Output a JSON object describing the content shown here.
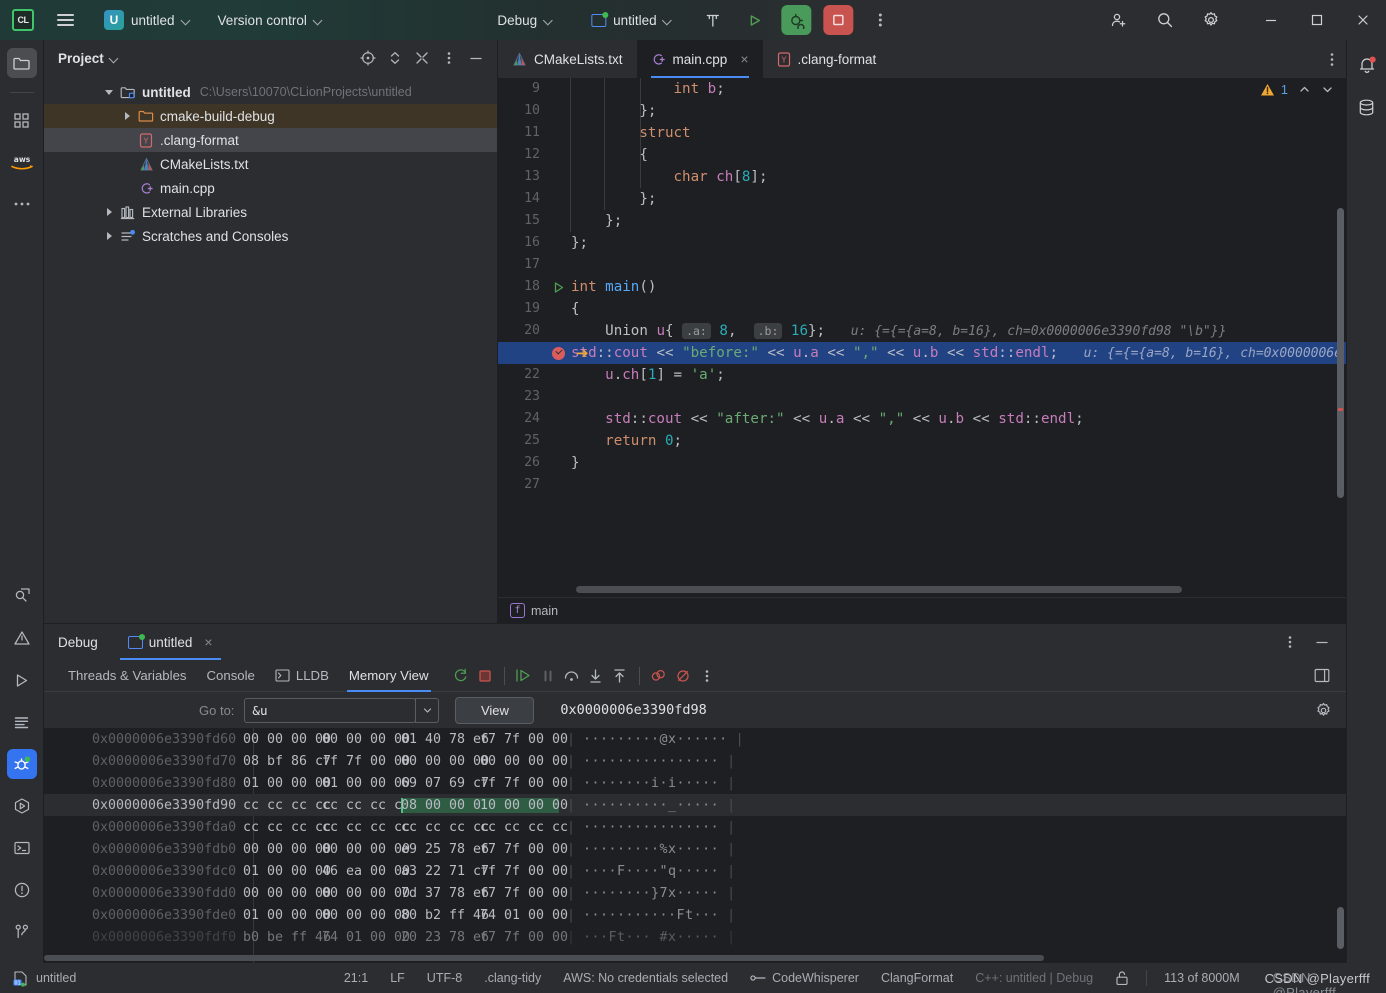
{
  "titlebar": {
    "logo": "CL",
    "menu_icon": "hamburger-menu-icon",
    "project_badge": "U",
    "project_name": "untitled",
    "version_control": "Version control",
    "run_config_mode": "Debug",
    "run_config_name": "untitled",
    "build_icon": "hammer-icon",
    "run_icon": "run-triangle-icon",
    "debug_icon": "debug-bug-icon",
    "stop_icon": "stop-square-icon",
    "more_icon": "more-vertical-icon",
    "add_user_icon": "add-user-icon",
    "search_icon": "search-icon",
    "settings_icon": "gear-icon",
    "minimize_icon": "window-minimize-icon",
    "maximize_icon": "window-maximize-icon",
    "close_icon": "window-close-icon"
  },
  "left_rail": {
    "items": [
      {
        "name": "project-tool-icon",
        "label": "Project",
        "active": true
      },
      {
        "name": "structure-tool-icon",
        "label": "Structure",
        "active": false
      },
      {
        "name": "aws-tool-icon",
        "label": "AWS",
        "active": false
      },
      {
        "name": "more-tools-icon",
        "label": "More tools",
        "active": false
      }
    ],
    "bottom_items": [
      {
        "name": "find-tool-icon",
        "label": "Find",
        "active": false
      },
      {
        "name": "problems-tool-icon",
        "label": "Problems",
        "active": false
      },
      {
        "name": "run-tool-icon",
        "label": "Run",
        "active": false
      },
      {
        "name": "todo-tool-icon",
        "label": "TODO",
        "active": false
      },
      {
        "name": "debug-tool-icon",
        "label": "Debug",
        "active": true
      },
      {
        "name": "cmake-tool-icon",
        "label": "CMake",
        "active": false
      },
      {
        "name": "terminal-tool-icon",
        "label": "Terminal",
        "active": false
      },
      {
        "name": "problems-alert-icon",
        "label": "Problems",
        "active": false
      },
      {
        "name": "git-branch-icon",
        "label": "Git",
        "active": false
      }
    ]
  },
  "right_rail": {
    "items": [
      {
        "name": "notifications-bell-icon",
        "label": "Notifications",
        "badge": true
      },
      {
        "name": "database-icon",
        "label": "Database",
        "badge": false
      }
    ]
  },
  "project_panel": {
    "title": "Project",
    "actions": [
      "locate-icon",
      "expand-collapse-icon",
      "collapse-all-icon",
      "options-icon",
      "hide-icon"
    ],
    "tree": [
      {
        "label": "untitled",
        "path": "C:\\Users\\10070\\CLionProjects\\untitled",
        "icon": "module-folder-icon",
        "depth": 0,
        "twisty": "open",
        "state": "none"
      },
      {
        "label": "cmake-build-debug",
        "path": "",
        "icon": "folder-icon",
        "depth": 1,
        "twisty": "closed",
        "state": "highlight"
      },
      {
        "label": ".clang-format",
        "path": "",
        "icon": "yaml-file-icon",
        "depth": 1,
        "twisty": "none",
        "state": "selected"
      },
      {
        "label": "CMakeLists.txt",
        "path": "",
        "icon": "cmake-file-icon",
        "depth": 1,
        "twisty": "none",
        "state": "none"
      },
      {
        "label": "main.cpp",
        "path": "",
        "icon": "cpp-file-icon",
        "depth": 1,
        "twisty": "none",
        "state": "none"
      },
      {
        "label": "External Libraries",
        "path": "",
        "icon": "libraries-icon",
        "depth": 0,
        "twisty": "closed",
        "state": "none"
      },
      {
        "label": "Scratches and Consoles",
        "path": "",
        "icon": "scratches-icon",
        "depth": 0,
        "twisty": "closed",
        "state": "none"
      }
    ]
  },
  "editor": {
    "tabs": [
      {
        "label": "CMakeLists.txt",
        "icon": "cmake-file-icon",
        "active": false,
        "closable": false
      },
      {
        "label": "main.cpp",
        "icon": "cpp-file-icon",
        "active": true,
        "closable": true
      },
      {
        "label": ".clang-format",
        "icon": "yaml-file-icon",
        "active": false,
        "closable": false
      }
    ],
    "tab_more_icon": "more-vertical-icon",
    "warning_count": "1",
    "warning_icon": "warning-triangle-icon",
    "prev_icon": "chevron-up-icon",
    "next_icon": "chevron-down-icon",
    "breadcrumb": "main",
    "breadcrumb_icon": "function-badge-icon",
    "lines": [
      {
        "n": "9",
        "code": "            int b;"
      },
      {
        "n": "10",
        "code": "        };"
      },
      {
        "n": "11",
        "code": "        struct"
      },
      {
        "n": "12",
        "code": "        {"
      },
      {
        "n": "13",
        "code": "            char ch[8];"
      },
      {
        "n": "14",
        "code": "        };"
      },
      {
        "n": "15",
        "code": "    };"
      },
      {
        "n": "16",
        "code": "};"
      },
      {
        "n": "17",
        "code": ""
      },
      {
        "n": "18",
        "code": "int main()",
        "gutter": "run-marker"
      },
      {
        "n": "19",
        "code": "{"
      },
      {
        "n": "20",
        "code": "    Union u{ .a: 8,  .b: 16};",
        "hint": "u: {={={a=8, b=16}, ch=0x0000006e3390fd98 \"\\b\"}}"
      },
      {
        "n": "21",
        "code": "    std::cout << \"before:\" << u.a << \",\" << u.b << std::endl;",
        "hint": "u: {={={a=8, b=16}, ch=0x0000006e",
        "gutter": "breakpoint",
        "current": true
      },
      {
        "n": "22",
        "code": "    u.ch[1] = 'a';"
      },
      {
        "n": "23",
        "code": ""
      },
      {
        "n": "24",
        "code": "    std::cout << \"after:\" << u.a << \",\" << u.b << std::endl;"
      },
      {
        "n": "25",
        "code": "    return 0;"
      },
      {
        "n": "26",
        "code": "}"
      },
      {
        "n": "27",
        "code": ""
      }
    ]
  },
  "debug_panel": {
    "title": "Debug",
    "session_tab": "untitled",
    "session_close_icon": "close-icon",
    "session_icon": "run-config-icon",
    "options_icon": "more-vertical-icon",
    "hide_icon": "hide-icon",
    "tabs": [
      {
        "label": "Threads & Variables",
        "active": false,
        "icon": ""
      },
      {
        "label": "Console",
        "active": false,
        "icon": ""
      },
      {
        "label": "LLDB",
        "active": false,
        "icon": "console-icon"
      },
      {
        "label": "Memory View",
        "active": true,
        "icon": ""
      }
    ],
    "toolbar_icons": [
      "rerun-icon",
      "stop-icon",
      "resume-icon",
      "pause-icon",
      "step-over-icon",
      "step-into-icon",
      "step-out-icon",
      "mute-breakpoints-icon",
      "view-breakpoints-icon",
      "more-vertical-icon"
    ],
    "layout_icon": "layout-settings-icon",
    "goto": {
      "label": "Go to:",
      "value": "&u",
      "dropdown_icon": "chevron-down-icon",
      "view_button": "View",
      "address": "0x0000006e3390fd98",
      "settings_icon": "gear-icon"
    },
    "memory_rows": [
      {
        "addr": "0x0000006e3390fd60",
        "g": [
          "00 00 00 00",
          "00 00 00 00",
          "01 40 78 e6",
          "f7 7f 00 00"
        ],
        "ascii": "·········@x······",
        "cur": false,
        "hl": []
      },
      {
        "addr": "0x0000006e3390fd70",
        "g": [
          "08 bf 86 c7",
          "ff 7f 00 00",
          "00 00 00 00",
          "00 00 00 00"
        ],
        "ascii": "················",
        "cur": false,
        "hl": []
      },
      {
        "addr": "0x0000006e3390fd80",
        "g": [
          "01 00 00 00",
          "01 00 00 00",
          "69 07 69 c7",
          "ff 7f 00 00"
        ],
        "ascii": "········i·i·····",
        "cur": false,
        "hl": []
      },
      {
        "addr": "0x0000006e3390fd90",
        "g": [
          "cc cc cc cc",
          "cc cc cc cc",
          "08 00 00 00",
          "10 00 00 00"
        ],
        "ascii": "··········_·····",
        "cur": true,
        "hl": [
          2,
          3
        ]
      },
      {
        "addr": "0x0000006e3390fda0",
        "g": [
          "cc cc cc cc",
          "cc cc cc cc",
          "cc cc cc cc",
          "cc cc cc cc"
        ],
        "ascii": "················",
        "cur": false,
        "hl": []
      },
      {
        "addr": "0x0000006e3390fdb0",
        "g": [
          "00 00 00 00",
          "00 00 00 00",
          "e9 25 78 e6",
          "f7 7f 00 00"
        ],
        "ascii": "·········%x·····",
        "cur": false,
        "hl": []
      },
      {
        "addr": "0x0000006e3390fdc0",
        "g": [
          "01 00 00 00",
          "46 ea 00 00",
          "a3 22 71 c7",
          "ff 7f 00 00"
        ],
        "ascii": "····F····\"q·····",
        "cur": false,
        "hl": []
      },
      {
        "addr": "0x0000006e3390fdd0",
        "g": [
          "00 00 00 00",
          "00 00 00 00",
          "7d 37 78 e6",
          "f7 7f 00 00"
        ],
        "ascii": "········}7x·····",
        "cur": false,
        "hl": []
      },
      {
        "addr": "0x0000006e3390fde0",
        "g": [
          "01 00 00 00",
          "00 00 00 00",
          "80 b2 ff 46",
          "74 01 00 00"
        ],
        "ascii": "···········Ft···",
        "cur": false,
        "hl": []
      },
      {
        "addr": "0x0000006e3390fdf0",
        "g": [
          "b0 be ff 46",
          "74 01 00 00",
          "20 23 78 e6",
          "f7 7f 00 00"
        ],
        "ascii": "···Ft··· #x·····",
        "cur": false,
        "hl": []
      }
    ]
  },
  "status_bar": {
    "project_icon": "project-status-icon",
    "project_name": "untitled",
    "caret": "21:1",
    "line_sep": "LF",
    "encoding": "UTF-8",
    "inspection": ".clang-tidy",
    "aws": "AWS: No credentials selected",
    "codewhisperer": "CodeWhisperer",
    "codewhisperer_icon": "codewhisperer-icon",
    "clangformat": "ClangFormat",
    "toolchain": "C++: untitled | Debug",
    "lock_icon": "unlock-icon",
    "memory": "113 of 8000M",
    "watermark_back": "CSDN @Playerfff",
    "watermark_front": "CSDN @Playerfff"
  },
  "colors": {
    "accent_blue": "#3574f0",
    "selection_blue": "#214283",
    "run_green": "#4a9a5c",
    "stop_red": "#c9544f",
    "memory_highlight": "#2f5d44",
    "warn_yellow": "#f0a732",
    "panel_bg": "#2b2d30",
    "editor_bg": "#1e1f22"
  }
}
